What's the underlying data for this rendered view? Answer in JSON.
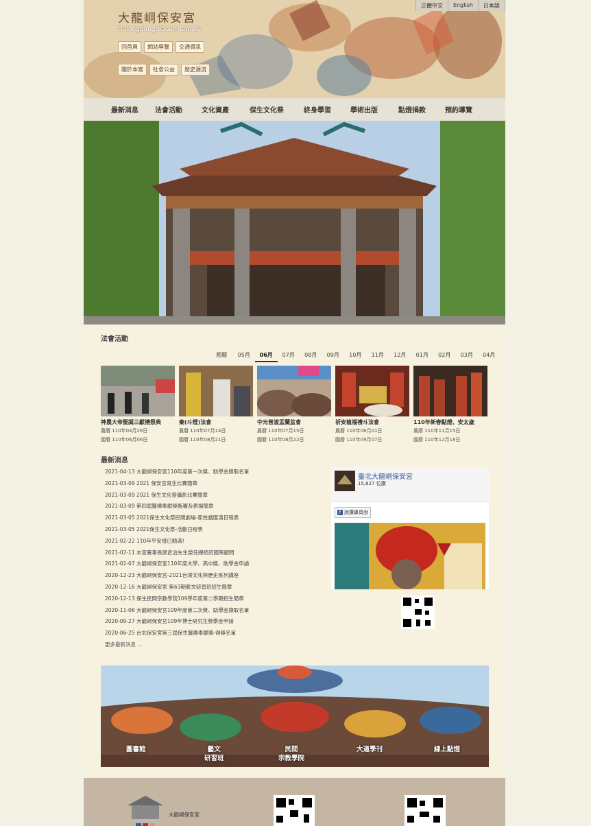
{
  "lang": [
    "正體中文",
    "English",
    "日本語"
  ],
  "brand": {
    "zh": "大龍峒保安宮",
    "en": "Dalongdong Baoan Temple"
  },
  "header_links": [
    "回首頁",
    "網站導覽",
    "交通資訊",
    "關於本宮",
    "社會公益",
    "歷史源流"
  ],
  "nav": [
    "最新消息",
    "法會活動",
    "文化資產",
    "保生文化祭",
    "終身學習",
    "學術出版",
    "點燈捐款",
    "預約導覽"
  ],
  "events_title": "法會活動",
  "months": [
    "國曆",
    "05月",
    "06月",
    "07月",
    "08月",
    "09月",
    "10月",
    "11月",
    "12月",
    "01月",
    "02月",
    "03月",
    "04月"
  ],
  "active_month": "06月",
  "events": [
    {
      "title": "神農大帝聖誕三獻禮祭典",
      "d1": "農曆 110年04月26日",
      "d2": "國曆 110年06月06日"
    },
    {
      "title": "秦(斗燈)法會",
      "d1": "農曆 110年07月14日",
      "d2": "國曆 110年08月21日"
    },
    {
      "title": "中元普渡盂蘭盆會",
      "d1": "農曆 110年07月15日",
      "d2": "國曆 110年08月22日"
    },
    {
      "title": "祈安植福禮斗法會",
      "d1": "農曆 110年08月01日",
      "d2": "國曆 110年09月07日"
    },
    {
      "title": "110年新春點燈、安太歲",
      "d1": "農曆 110年11月15日",
      "d2": "國曆 110年12月18日"
    }
  ],
  "news_title": "最新消息",
  "news": [
    "2021-04-13 大龍峒保安宮110年度第一次獎、助學金錄取名單",
    "2021-03-09 2021 保安宮寫生比賽簡章",
    "2021-03-09 2021 保生文化祭攝影比賽簡章",
    "2021-03-09 第四屆醫療奉獻獎甄審及表揚簡章",
    "2021-03-05 2021保生文化祭民間劇場-家姓戲匯演日程表",
    "2021-03-05 2021保生文化祭-活動日程表",
    "2021-02-22 110年平安燈已額滿！",
    "2021-02-11 本宮董事長廖武治先生榮任總統府國策顧問",
    "2021-02-07 大龍峒保安宮110年度大學、高中獎、助學金申請",
    "2020-12-23 大龍峒保安宮-2021台灣文化與歷史系列講座",
    "2020-12-16 大龍峒保安宮 第63期藝文研習班招生簡章",
    "2020-12-13 保生民間宗教學院109學年度第二學期招生簡章",
    "2020-11-06 大龍峒保安宮109年度第二次獎、助學金錄取名單",
    "2020-09-27 大龍峒保安宮109年博士研究生獎學金申請",
    "2020-06-25 台北保安宮第三屆保生醫療奉獻獎-得獎名單"
  ],
  "news_more": "更多最新消息 ...",
  "fb": {
    "name": "臺北大龍峒保安宮",
    "likes": "15,827 位讚",
    "button": "說讚專頁說"
  },
  "banner_links": [
    "圖書館",
    "藝文\n研習班",
    "民間\n宗教學院",
    "大道學刊",
    "線上點燈"
  ],
  "footer_text": "大龍峒保安宮",
  "icons": [
    "facebook-icon",
    "qr-code-icon",
    "temple-logo-icon"
  ]
}
